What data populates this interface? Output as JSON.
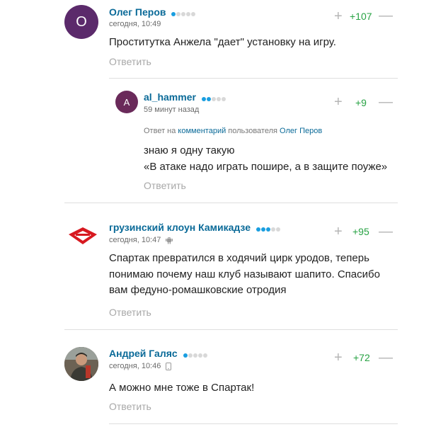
{
  "reply_label": "Ответить",
  "comments": [
    {
      "author": "Олег Перов",
      "avatar_letter": "О",
      "avatar_color": "#5b2a6b",
      "rating_dots": 1,
      "time": "сегодня, 10:49",
      "votes": "+107",
      "text": "Проститутка Анжела \"дает\" установку на игру."
    },
    {
      "author": "al_hammer",
      "avatar_letter": "A",
      "avatar_color": "#6a2a5a",
      "rating_dots": 2,
      "time": "59 минут назад",
      "votes": "+9",
      "reply_to": {
        "prefix": "Ответ на",
        "link": "комментарий",
        "middle": "пользователя",
        "user": "Олег Перов"
      },
      "text_lines": [
        "знаю я одну такую",
        "«В атаке надо играть пошире, а в защите поуже»"
      ]
    },
    {
      "author": "грузинский клоун Камикадзе",
      "rating_dots": 3,
      "time": "сегодня, 10:47",
      "device": "android-icon",
      "votes": "+95",
      "text_lines": [
        "Спартак превратился в ходячий цирк уродов, теперь",
        "понимаю почему наш клуб называют шапито. Спасибо",
        "вам федуно-ромашковские отродия"
      ]
    },
    {
      "author": "Андрей Галяс",
      "rating_dots": 1,
      "time": "сегодня, 10:46",
      "device": "phone-icon",
      "votes": "+72",
      "text": "А можно мне тоже в Спартак!"
    }
  ],
  "colors": {
    "author": "#0a6a98",
    "vote_positive": "#27a243",
    "dot_active": "#1a9ee0",
    "dot_inactive": "#d8d8d8",
    "reply": "#a8a8a8"
  }
}
